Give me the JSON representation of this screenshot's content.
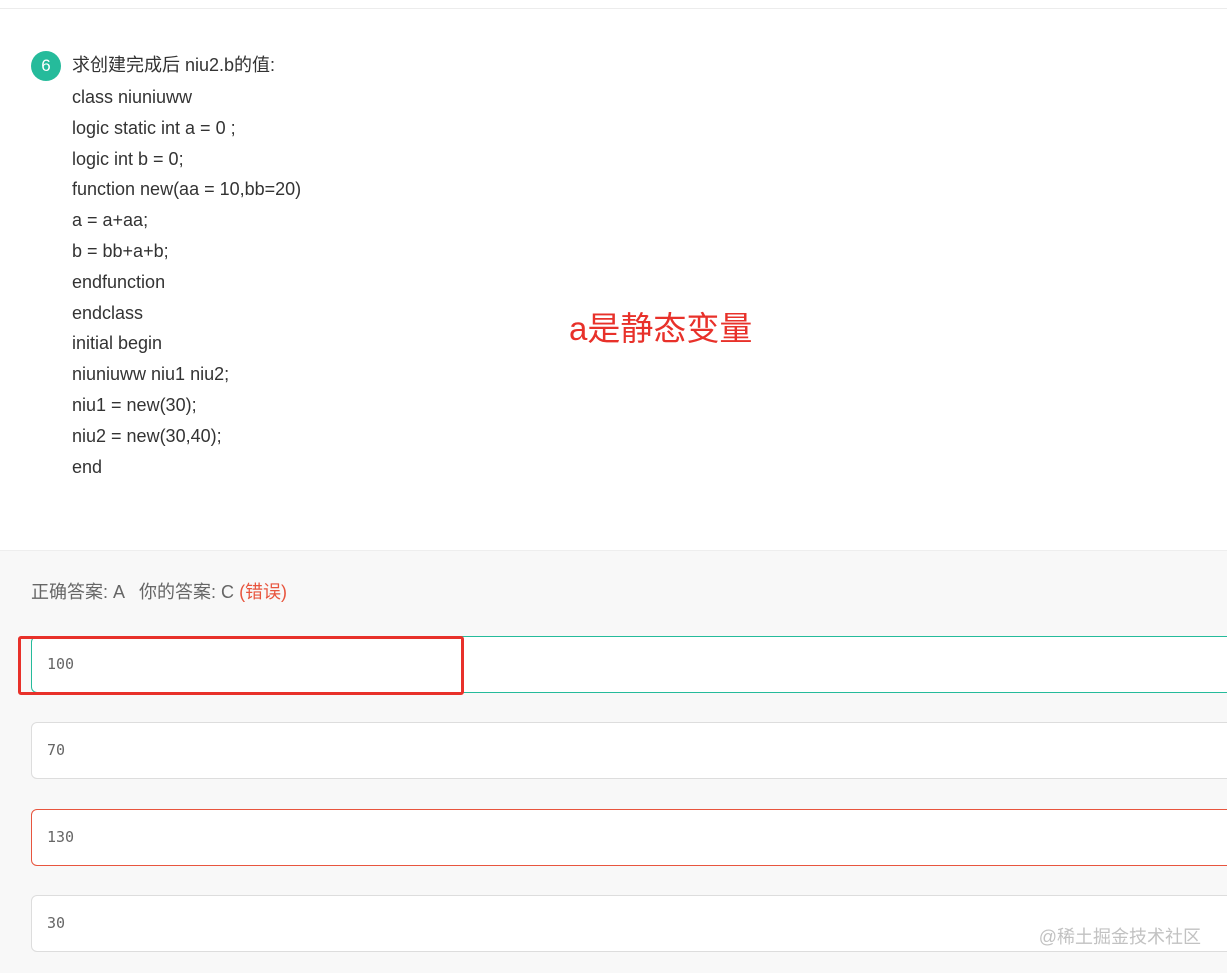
{
  "question": {
    "number": "6",
    "title": "求创建完成后 niu2.b的值:",
    "code_lines": [
      "class niuniuww",
      "logic static int a = 0 ;",
      "logic int b = 0;",
      "function new(aa = 10,bb=20)",
      "a = a+aa;",
      "b = bb+a+b;",
      "endfunction",
      "endclass",
      "initial begin",
      "niuniuww niu1 niu2;",
      "niu1 = new(30);",
      "niu2 = new(30,40);",
      "end"
    ]
  },
  "annotation": "a是静态变量",
  "answer": {
    "correct_label": "正确答案: A",
    "your_label": "你的答案: C",
    "wrong_tag": "(错误)"
  },
  "options": [
    {
      "value": "100",
      "state": "correct"
    },
    {
      "value": "70",
      "state": "neutral"
    },
    {
      "value": "130",
      "state": "wrong"
    },
    {
      "value": "30",
      "state": "neutral"
    }
  ],
  "watermark": "@稀土掘金技术社区",
  "colors": {
    "accent_green": "#25bb9b",
    "error_red": "#e8553e",
    "annotation_red": "#e8312a"
  }
}
